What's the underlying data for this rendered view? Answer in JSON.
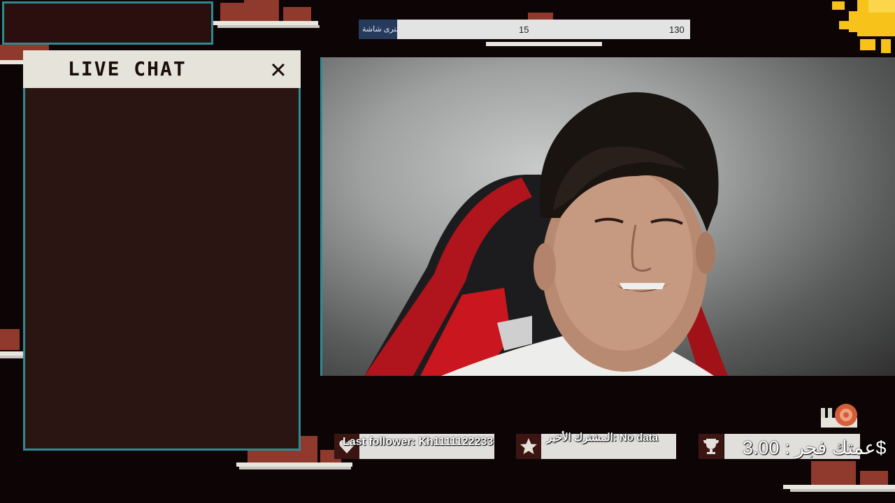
{
  "chat": {
    "title": "LIVE CHAT",
    "close_label": "✕"
  },
  "goal": {
    "label": "نشترى شاشة",
    "current": "15",
    "target": "130",
    "progress_fraction": 0.115,
    "fill_color": "#263a5c"
  },
  "widgets": {
    "last_follower": "Last follower: Kh1111122233",
    "last_subscriber": "المشترك الأخير: No data",
    "top_donation": "عمتك فجر : 3.00$"
  },
  "icons": {
    "follower": "heart-icon",
    "subscriber": "star-icon",
    "donation": "trophy-icon",
    "sun": "sun-icon",
    "snail": "snail-icon"
  },
  "colors": {
    "background": "#0d0405",
    "accent_teal": "#2e8b93",
    "panel_brown": "#2b1513",
    "cloud_red": "#8f3a2c"
  }
}
